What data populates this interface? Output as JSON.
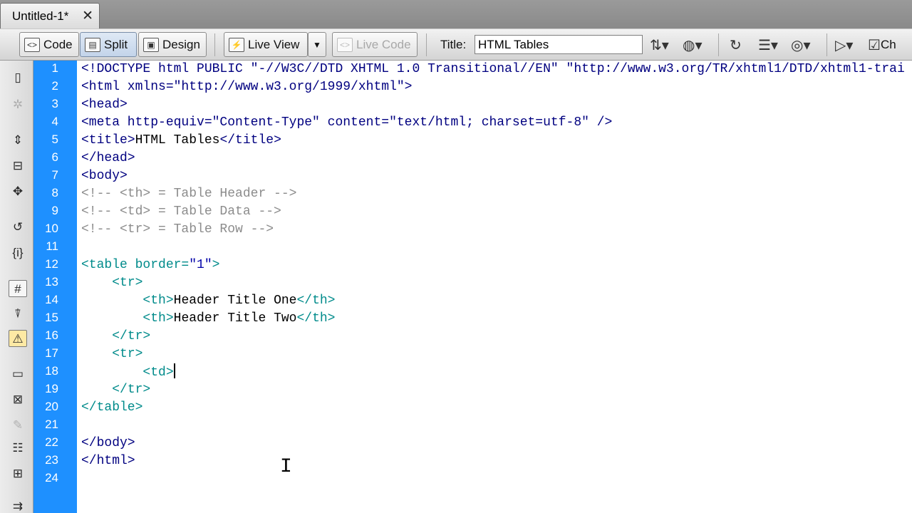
{
  "tab": {
    "label": "Untitled-1*",
    "close": "✕"
  },
  "toolbar": {
    "code_label": "Code",
    "split_label": "Split",
    "design_label": "Design",
    "live_view_label": "Live View",
    "live_code_label": "Live Code",
    "title_label": "Title:",
    "title_value": "HTML Tables",
    "check_label": "Ch"
  },
  "icons": {
    "code": "code-view-icon",
    "split": "split-view-icon",
    "design": "design-view-icon",
    "live_view": "live-view-icon",
    "live_code": "live-code-icon",
    "file_management": "file-management-icon",
    "preview": "globe-preview-icon",
    "refresh": "refresh-icon",
    "view_options": "view-options-icon",
    "visual_aids": "visual-aids-icon",
    "validate": "validate-markup-icon",
    "check_page": "check-page-icon"
  },
  "colors": {
    "gutter": "#1e90ff",
    "tag": "#000080",
    "tag_teal": "#008b8b",
    "attr_value": "#0000a8",
    "comment": "#8c8c8c"
  },
  "line_numbers": [
    "1",
    "2",
    "3",
    "4",
    "5",
    "6",
    "7",
    "8",
    "9",
    "10",
    "11",
    "12",
    "13",
    "14",
    "15",
    "16",
    "17",
    "18",
    "19",
    "20",
    "21",
    "22",
    "23",
    "24"
  ],
  "code_lines": [
    {
      "parts": [
        {
          "t": "<!DOCTYPE html PUBLIC \"-//W3C//DTD XHTML 1.0 Transitional//EN\" \"http://www.w3.org/TR/xhtml1/DTD/xhtml1-trai",
          "c": "c-navy"
        }
      ]
    },
    {
      "parts": [
        {
          "t": "<html xmlns=\"http://www.w3.org/1999/xhtml\">",
          "c": "c-navy"
        }
      ]
    },
    {
      "parts": [
        {
          "t": "<head>",
          "c": "c-navy"
        }
      ]
    },
    {
      "parts": [
        {
          "t": "<meta http-equiv=\"Content-Type\" content=\"text/html; charset=utf-8\" />",
          "c": "c-navy"
        }
      ]
    },
    {
      "parts": [
        {
          "t": "<title>",
          "c": "c-navy"
        },
        {
          "t": "HTML Tables",
          "c": "c-txt"
        },
        {
          "t": "</title>",
          "c": "c-navy"
        }
      ]
    },
    {
      "parts": [
        {
          "t": "</head>",
          "c": "c-navy"
        }
      ]
    },
    {
      "parts": [
        {
          "t": "<body>",
          "c": "c-navy"
        }
      ]
    },
    {
      "parts": [
        {
          "t": "<!-- <th> = Table Header -->",
          "c": "c-cmt"
        }
      ]
    },
    {
      "parts": [
        {
          "t": "<!-- <td> = Table Data -->",
          "c": "c-cmt"
        }
      ]
    },
    {
      "parts": [
        {
          "t": "<!-- <tr> = Table Row -->",
          "c": "c-cmt"
        }
      ]
    },
    {
      "parts": [
        {
          "t": "",
          "c": "c-txt"
        }
      ]
    },
    {
      "parts": [
        {
          "t": "<table border=",
          "c": "c-teal"
        },
        {
          "t": "\"1\"",
          "c": "c-green"
        },
        {
          "t": ">",
          "c": "c-teal"
        }
      ]
    },
    {
      "parts": [
        {
          "t": "    ",
          "c": "c-txt"
        },
        {
          "t": "<tr>",
          "c": "c-teal"
        }
      ]
    },
    {
      "parts": [
        {
          "t": "        ",
          "c": "c-txt"
        },
        {
          "t": "<th>",
          "c": "c-teal"
        },
        {
          "t": "Header Title One",
          "c": "c-txt"
        },
        {
          "t": "</th>",
          "c": "c-teal"
        }
      ]
    },
    {
      "parts": [
        {
          "t": "        ",
          "c": "c-txt"
        },
        {
          "t": "<th>",
          "c": "c-teal"
        },
        {
          "t": "Header Title Two",
          "c": "c-txt"
        },
        {
          "t": "</th>",
          "c": "c-teal"
        }
      ]
    },
    {
      "parts": [
        {
          "t": "    ",
          "c": "c-txt"
        },
        {
          "t": "</tr>",
          "c": "c-teal"
        }
      ]
    },
    {
      "parts": [
        {
          "t": "    ",
          "c": "c-txt"
        },
        {
          "t": "<tr>",
          "c": "c-teal"
        }
      ]
    },
    {
      "parts": [
        {
          "t": "        ",
          "c": "c-txt"
        },
        {
          "t": "<td>",
          "c": "c-teal"
        }
      ],
      "caret": true
    },
    {
      "parts": [
        {
          "t": "    ",
          "c": "c-txt"
        },
        {
          "t": "</tr>",
          "c": "c-teal"
        }
      ]
    },
    {
      "parts": [
        {
          "t": "</table>",
          "c": "c-teal"
        }
      ]
    },
    {
      "parts": [
        {
          "t": "",
          "c": "c-txt"
        }
      ]
    },
    {
      "parts": [
        {
          "t": "</body>",
          "c": "c-navy"
        }
      ]
    },
    {
      "parts": [
        {
          "t": "</html>",
          "c": "c-navy"
        }
      ]
    },
    {
      "parts": [
        {
          "t": "",
          "c": "c-txt"
        }
      ]
    }
  ]
}
